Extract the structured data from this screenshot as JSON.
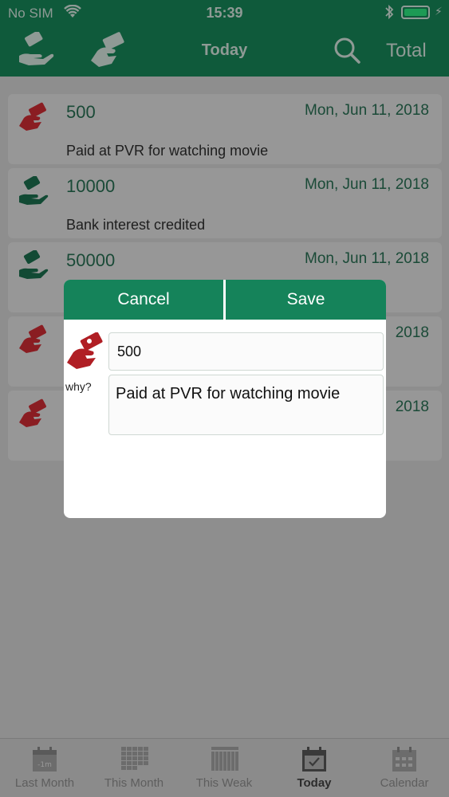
{
  "status": {
    "carrier": "No SIM",
    "time": "15:39"
  },
  "nav": {
    "title": "Today",
    "total_label": "Total"
  },
  "entries": [
    {
      "amount": "500",
      "date": "Mon, Jun 11, 2018",
      "note": "Paid at PVR for watching movie",
      "kind": "expense"
    },
    {
      "amount": "10000",
      "date": "Mon, Jun 11, 2018",
      "note": "Bank interest credited",
      "kind": "income"
    },
    {
      "amount": "50000",
      "date": "Mon, Jun 11, 2018",
      "note": "",
      "kind": "income"
    },
    {
      "amount": "",
      "date": "2018",
      "note": "",
      "kind": "expense"
    },
    {
      "amount": "",
      "date": "2018",
      "note": "",
      "kind": "expense"
    }
  ],
  "dialog": {
    "cancel_label": "Cancel",
    "save_label": "Save",
    "why_label": "why?",
    "amount_value": "500",
    "reason_value": "Paid at PVR for watching movie"
  },
  "tabs": [
    {
      "label": "Last Month",
      "badge": "-1m"
    },
    {
      "label": "This Month"
    },
    {
      "label": "This Weak"
    },
    {
      "label": "Today",
      "active": true
    },
    {
      "label": "Calendar"
    }
  ],
  "colors": {
    "primary": "#15835a",
    "expense": "#b01e24",
    "income": "#15835a"
  }
}
